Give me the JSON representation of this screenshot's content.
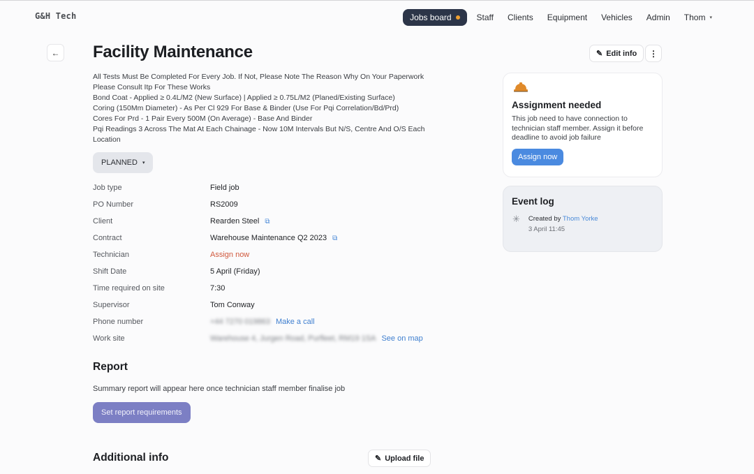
{
  "app": {
    "logo": "G&H Tech"
  },
  "nav": {
    "items": [
      {
        "label": "Jobs board",
        "active": true,
        "badge_color": "#f0a030"
      },
      {
        "label": "Staff"
      },
      {
        "label": "Clients"
      },
      {
        "label": "Equipment"
      },
      {
        "label": "Vehicles"
      },
      {
        "label": "Admin"
      }
    ],
    "user": "Thom",
    "user_caret": "▾"
  },
  "header": {
    "back_icon": "←",
    "title": "Facility Maintenance",
    "edit_label": "Edit info",
    "edit_icon": "✎",
    "more_icon": "⋮"
  },
  "description": [
    "All Tests Must Be Completed For Every Job. If Not, Please Note The Reason Why On Your Paperwork",
    "Please Consult Itp For These Works",
    "Bond Coat - Applied ≥ 0.4L/M2 (New Surface) | Applied ≥ 0.75L/M2 (Planed/Existing Surface)",
    "Coring (150Mm Diameter) - As Per Cl 929 For Base & Binder (Use For Pqi Correlation/Bd/Prd)",
    "Cores For Prd - 1 Pair Every 500M (On Average) - Base And Binder",
    "Pqi Readings 3 Across The Mat At Each Chainage - Now 10M Intervals But N/S, Centre And O/S Each Location"
  ],
  "status": {
    "label": "PLANNED",
    "caret": "▾"
  },
  "details": {
    "job_type": {
      "label": "Job type",
      "value": "Field job"
    },
    "po_number": {
      "label": "PO Number",
      "value": "RS2009"
    },
    "client": {
      "label": "Client",
      "value": "Rearden Steel",
      "link_icon": "⧉"
    },
    "contract": {
      "label": "Contract",
      "value": "Warehouse Maintenance Q2 2023",
      "link_icon": "⧉"
    },
    "technician": {
      "label": "Technician",
      "value": "Assign now"
    },
    "shift_date": {
      "label": "Shift Date",
      "value": "5 April (Friday)"
    },
    "time_on_site": {
      "label": "Time required on site",
      "value": "7:30"
    },
    "supervisor": {
      "label": "Supervisor",
      "value": "Tom Conway"
    },
    "phone": {
      "label": "Phone number",
      "value": "+44 7270 019863",
      "action": "Make a call"
    },
    "work_site": {
      "label": "Work site",
      "value": "Warehouse 4, Jurgen Road, Purfleet, RM19 1SA",
      "action": "See on map"
    }
  },
  "report": {
    "title": "Report",
    "text": "Summary report will appear here once  technician staff member finalise job",
    "button": "Set report requirements"
  },
  "additional": {
    "title": "Additional info",
    "upload_label": "Upload file",
    "upload_icon": "✎"
  },
  "assignment_card": {
    "icon": "hard-hat",
    "title": "Assignment needed",
    "text": "This job need to have connection to technician staff member. Assign it before deadline to avoid job failure",
    "button": "Assign now"
  },
  "event_log": {
    "title": "Event log",
    "events": [
      {
        "icon": "✳",
        "prefix": "Created by",
        "author": "Thom Yorke",
        "time": "3 April 11:45"
      }
    ]
  },
  "colors": {
    "nav_active_bg": "#2c3548",
    "accent_blue": "#4a8ae0",
    "report_button": "#7c7fc4",
    "technician_red": "#d0583c",
    "hat_orange": "#e08a2a"
  }
}
